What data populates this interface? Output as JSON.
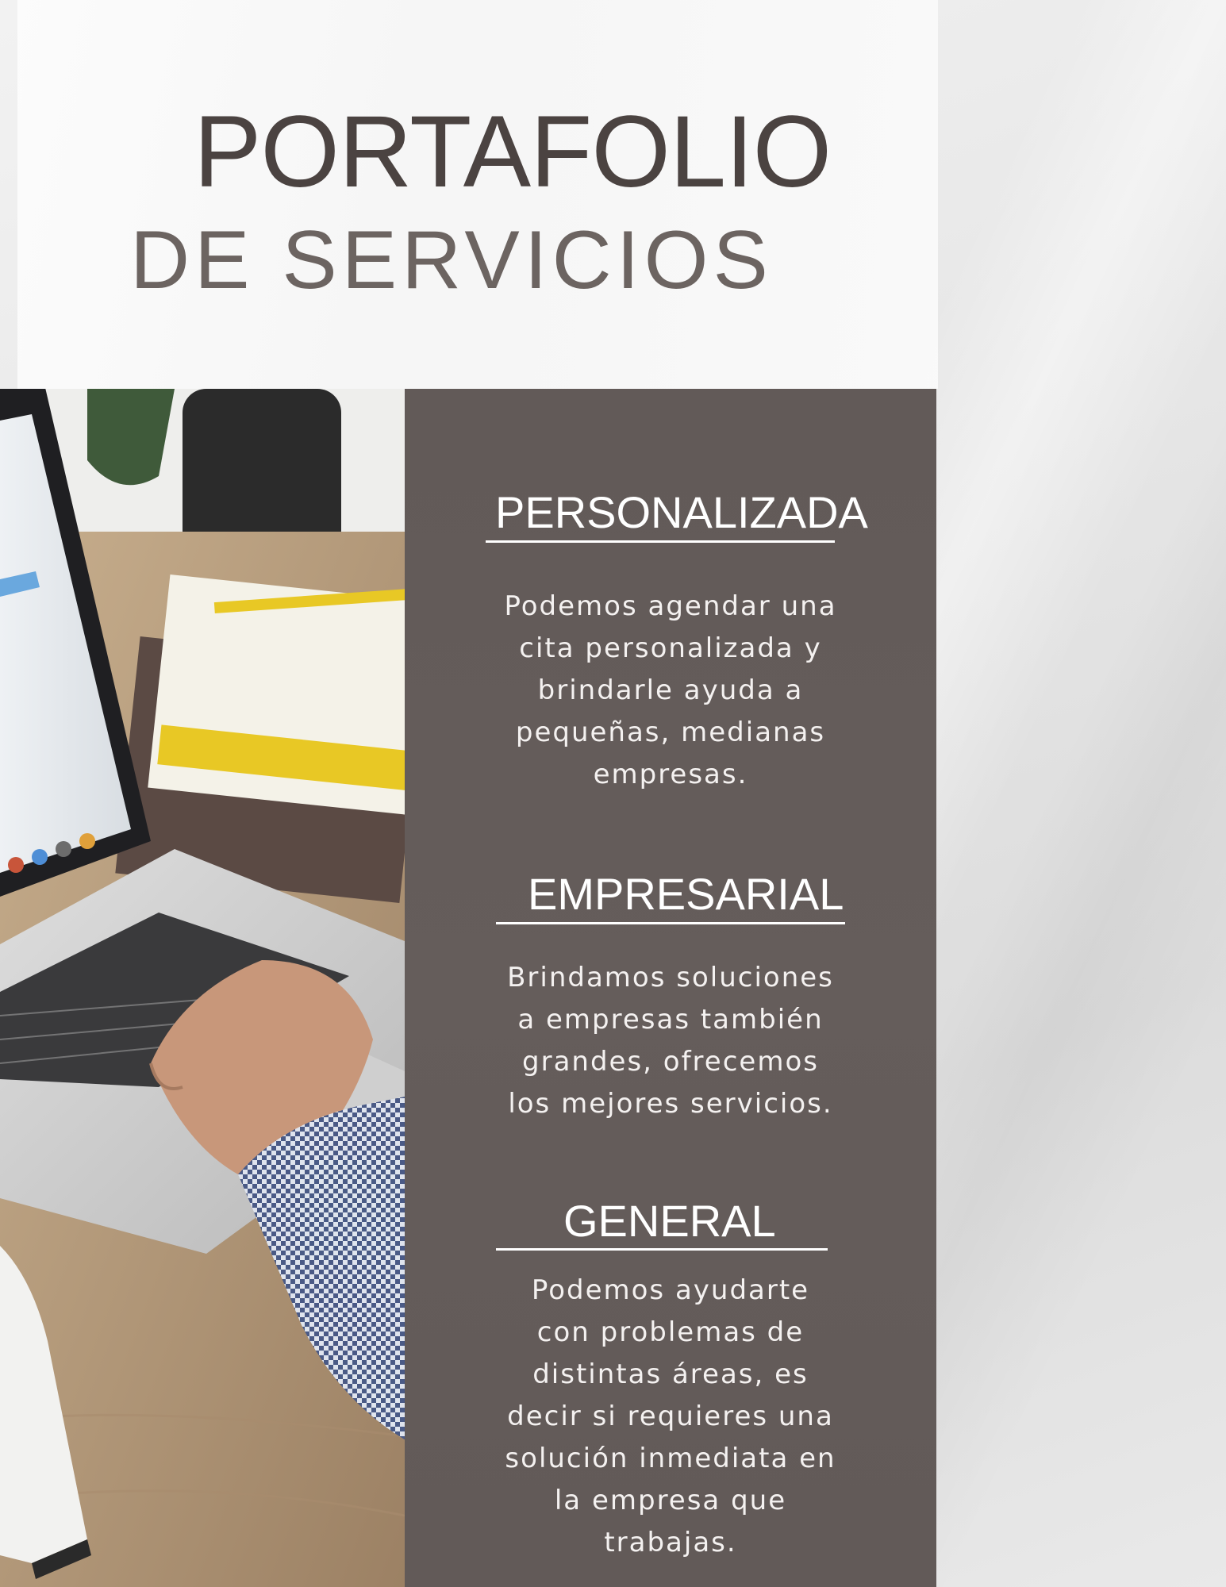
{
  "header": {
    "title_line1": "PORTAFOLIO",
    "title_line2": "DE SERVICIOS"
  },
  "sections": [
    {
      "heading": "PERSONALIZADA",
      "text": "Podemos agendar una\ncita personalizada y\nbrindarle ayuda a\npequeñas, medianas\nempresas."
    },
    {
      "heading": "EMPRESARIAL",
      "text": "Brindamos soluciones\na empresas también\ngrandes, ofrecemos\nlos mejores servicios."
    },
    {
      "heading": "GENERAL",
      "text": "Podemos ayudarte\ncon problemas de\ndistintas áreas, es\ndecir si requieres una\nsolución inmediata en\nla empresa que\ntrabajas."
    }
  ],
  "colors": {
    "panel": "#635b59",
    "title": "#4b4341",
    "subtitle": "#6c6461"
  }
}
